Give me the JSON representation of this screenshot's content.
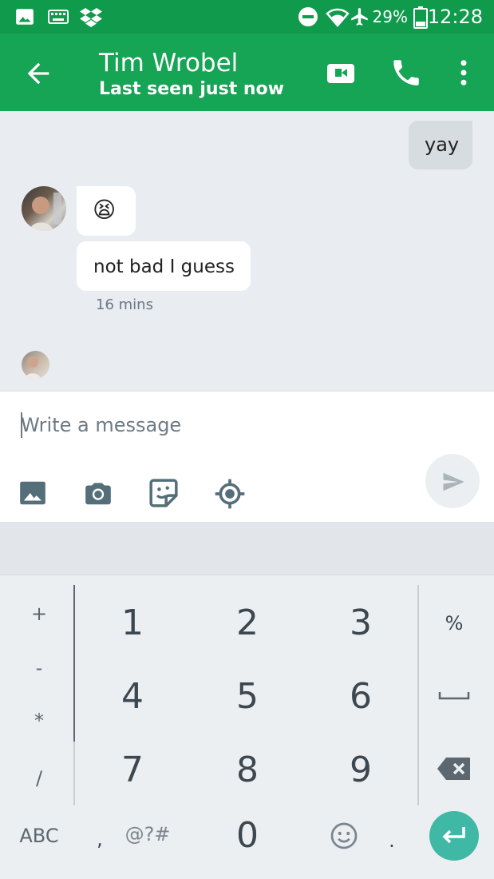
{
  "status_bar": {
    "battery_percent": "29%",
    "time": "12:28",
    "icons": [
      "image-notification-icon",
      "keyboard-notification-icon",
      "dropbox-icon",
      "do-not-disturb-icon",
      "wifi-icon",
      "airplane-mode-icon",
      "battery-icon"
    ]
  },
  "app_bar": {
    "contact_name": "Tim Wrobel",
    "last_seen": "Last seen just now",
    "icons": [
      "back-arrow-icon",
      "video-call-icon",
      "phone-call-icon",
      "more-options-icon"
    ]
  },
  "chat": {
    "messages": [
      {
        "direction": "outgoing",
        "text": "yay"
      },
      {
        "direction": "incoming",
        "text": "😫"
      },
      {
        "direction": "incoming",
        "text": "not bad I guess"
      }
    ],
    "timestamp": "16 mins"
  },
  "compose": {
    "placeholder": "Write a message",
    "value": "",
    "tools": [
      "gallery-icon",
      "camera-icon",
      "sticker-icon",
      "location-icon"
    ]
  },
  "keyboard": {
    "left_symbols": [
      "+",
      "-",
      "*",
      "/"
    ],
    "digits": [
      "1",
      "2",
      "3",
      "4",
      "5",
      "6",
      "7",
      "8",
      "9",
      "0"
    ],
    "right_keys": [
      "%",
      "␣"
    ],
    "bottom_row": {
      "abc": "ABC",
      "comma": ",",
      "symbols": "@?#",
      "period": "."
    }
  },
  "colors": {
    "app_bar_green": "#16a455",
    "status_bar_green": "#109a4c",
    "enter_key_teal": "#3fb8a6",
    "chat_background": "#e9ecf0"
  }
}
